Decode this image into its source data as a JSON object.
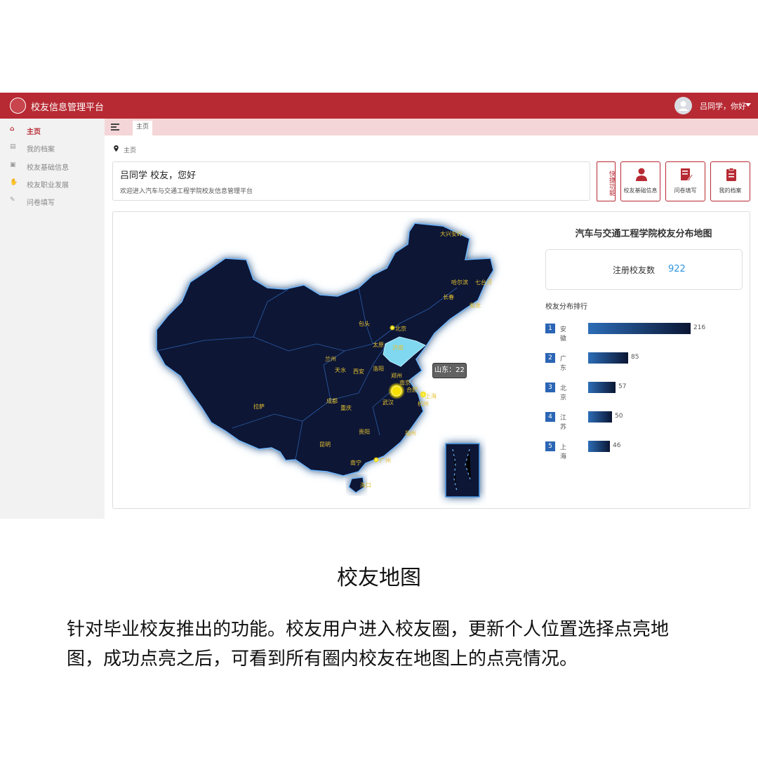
{
  "header": {
    "app_title": "校友信息管理平台",
    "user_greeting": "吕同学，你好"
  },
  "sidebar": {
    "items": [
      {
        "label": "主页",
        "icon": "home-icon",
        "active": true
      },
      {
        "label": "我的档案",
        "icon": "database-icon"
      },
      {
        "label": "校友基础信息",
        "icon": "id-card-icon"
      },
      {
        "label": "校友职业发展",
        "icon": "handshake-icon"
      },
      {
        "label": "问卷填写",
        "icon": "pencil-icon"
      }
    ]
  },
  "tabs": {
    "home": "主页"
  },
  "breadcrumb": "主页",
  "welcome": {
    "title": "吕同学 校友，您好",
    "subtitle": "欢迎进入汽车与交通工程学院校友信息管理平台"
  },
  "quick": {
    "label": "快捷功能",
    "buttons": [
      {
        "label": "校友基础信息",
        "icon": "user-icon"
      },
      {
        "label": "问卷填写",
        "icon": "edit-icon"
      },
      {
        "label": "我的档案",
        "icon": "clipboard-icon"
      }
    ]
  },
  "map_panel": {
    "title": "汽车与交通工程学院校友分布地图",
    "registered_label": "注册校友数",
    "registered_count": "922",
    "ranking_title": "校友分布排行",
    "tooltip": "山东：22",
    "ranking": [
      {
        "rank": "1",
        "name": "安徽",
        "value": 216
      },
      {
        "rank": "2",
        "name": "广东",
        "value": 85
      },
      {
        "rank": "3",
        "name": "北京",
        "value": 57
      },
      {
        "rank": "4",
        "name": "江苏",
        "value": 50
      },
      {
        "rank": "5",
        "name": "上海",
        "value": 46
      }
    ],
    "city_labels": [
      "大兴安岭",
      "哈尔滨",
      "七台河",
      "长春",
      "和龙",
      "北京",
      "太原",
      "包头",
      "兰州",
      "天水",
      "西安",
      "洛阳",
      "郑州",
      "合肥",
      "武汉",
      "重庆",
      "成都",
      "拉萨",
      "贵阳",
      "昆明",
      "南宁",
      "广州",
      "海口",
      "福州",
      "杭州",
      "南京",
      "上海",
      "济南"
    ],
    "colors": {
      "map_fill": "#0b1736",
      "glow": "#4fa6ff",
      "highlight": "#7fd8f0",
      "point": "#f5e000",
      "label": "#e6c232"
    }
  },
  "caption": {
    "heading": "校友地图",
    "body": "针对毕业校友推出的功能。校友用户进入校友圈，更新个人位置选择点亮地图，成功点亮之后，可看到所有圈内校友在地图上的点亮情况。"
  }
}
